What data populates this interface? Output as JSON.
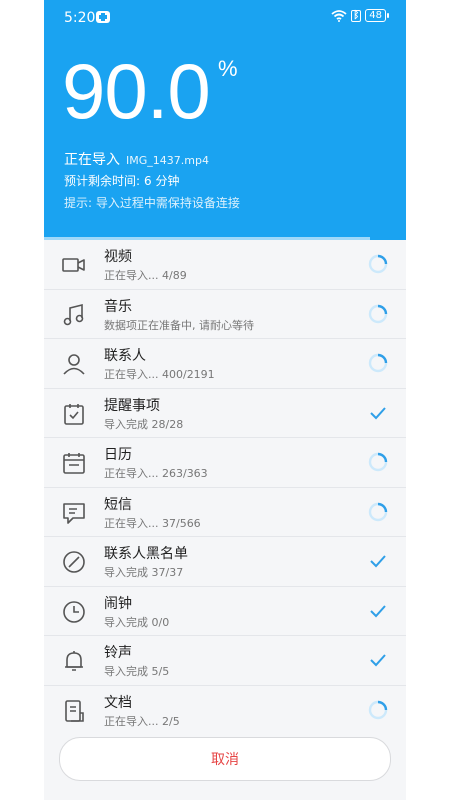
{
  "status_bar": {
    "time": "5:20",
    "battery": "48"
  },
  "progress": {
    "percent": "90.0",
    "percent_sign": "%",
    "value": 0.9
  },
  "status": {
    "importing_label": "正在导入",
    "file_name": "IMG_1437.mp4",
    "remaining_label": "预计剩余时间:",
    "remaining_value": "6 分钟",
    "hint": "提示: 导入过程中需保持设备连接"
  },
  "items": [
    {
      "title": "视频",
      "subtitle": "正在导入... 4/89",
      "icon": "video-icon",
      "state": "loading"
    },
    {
      "title": "音乐",
      "subtitle": "数据项正在准备中, 请耐心等待",
      "icon": "music-icon",
      "state": "loading"
    },
    {
      "title": "联系人",
      "subtitle": "正在导入... 400/2191",
      "icon": "person-icon",
      "state": "loading"
    },
    {
      "title": "提醒事项",
      "subtitle": "导入完成 28/28",
      "icon": "reminder-icon",
      "state": "done"
    },
    {
      "title": "日历",
      "subtitle": "正在导入... 263/363",
      "icon": "calendar-icon",
      "state": "loading"
    },
    {
      "title": "短信",
      "subtitle": "正在导入... 37/566",
      "icon": "message-icon",
      "state": "loading"
    },
    {
      "title": "联系人黑名单",
      "subtitle": "导入完成 37/37",
      "icon": "block-icon",
      "state": "done"
    },
    {
      "title": "闹钟",
      "subtitle": "导入完成 0/0",
      "icon": "clock-icon",
      "state": "done"
    },
    {
      "title": "铃声",
      "subtitle": "导入完成 5/5",
      "icon": "bell-icon",
      "state": "done"
    },
    {
      "title": "文档",
      "subtitle": "正在导入... 2/5",
      "icon": "document-icon",
      "state": "loading"
    }
  ],
  "cancel_label": "取消",
  "colors": {
    "accent": "#1aa3f1",
    "cancel": "#e64545",
    "check": "#2f9fe8"
  }
}
